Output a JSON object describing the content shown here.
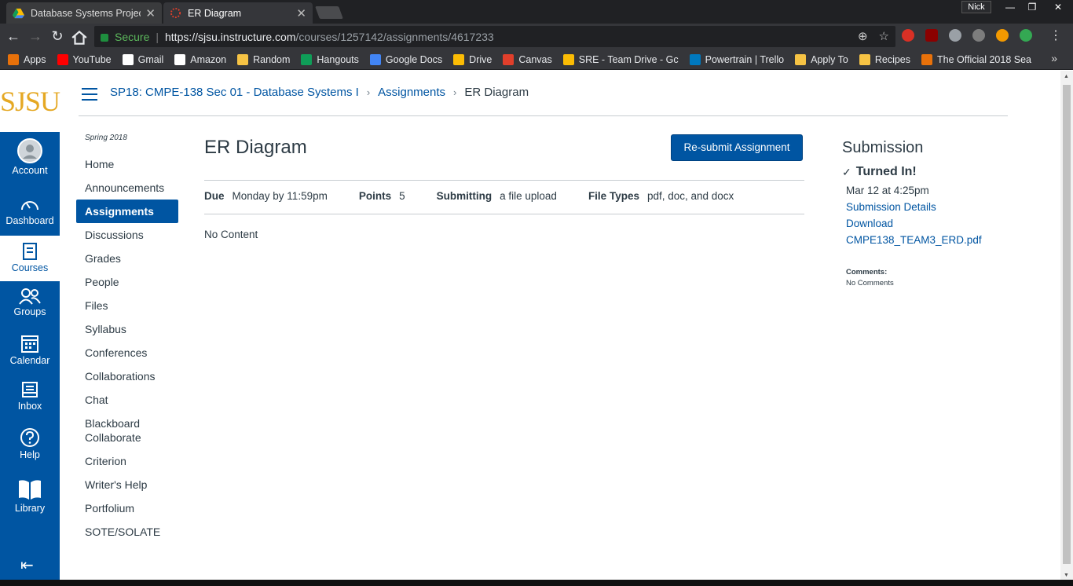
{
  "browser": {
    "tabs": [
      {
        "title": "Database Systems Projec",
        "active": false
      },
      {
        "title": "ER Diagram",
        "active": true
      }
    ],
    "profile": "Nick",
    "secure_label": "Secure",
    "url_host": "https://sjsu.instructure.com",
    "url_path": "/courses/1257142/assignments/4617233",
    "bookmarks": [
      {
        "label": "Apps",
        "icon": "apps-grid-icon",
        "color": "#e8710a"
      },
      {
        "label": "YouTube",
        "icon": "youtube-icon",
        "color": "#ff0000"
      },
      {
        "label": "Gmail",
        "icon": "gmail-icon",
        "color": "#ffffff"
      },
      {
        "label": "Amazon",
        "icon": "amazon-icon",
        "color": "#ffffff"
      },
      {
        "label": "Random",
        "icon": "folder-icon",
        "color": "#f6c344"
      },
      {
        "label": "Hangouts",
        "icon": "hangouts-icon",
        "color": "#0f9d58"
      },
      {
        "label": "Google Docs",
        "icon": "docs-icon",
        "color": "#4285f4"
      },
      {
        "label": "Drive",
        "icon": "drive-icon",
        "color": "#fbbc04"
      },
      {
        "label": "Canvas",
        "icon": "canvas-icon",
        "color": "#e13f2b"
      },
      {
        "label": "SRE - Team Drive - Gc",
        "icon": "drive-icon",
        "color": "#fbbc04"
      },
      {
        "label": "Powertrain | Trello",
        "icon": "trello-icon",
        "color": "#0079bf"
      },
      {
        "label": "Apply To",
        "icon": "folder-icon",
        "color": "#f6c344"
      },
      {
        "label": "Recipes",
        "icon": "folder-icon",
        "color": "#f6c344"
      },
      {
        "label": "The Official 2018 Sea",
        "icon": "bookmark-icon",
        "color": "#e8710a"
      }
    ],
    "more_bookmarks": "»"
  },
  "canvas": {
    "logo": "SJSU",
    "global_nav": [
      {
        "label": "Account",
        "icon": "account-icon",
        "current": false
      },
      {
        "label": "Dashboard",
        "icon": "dashboard-icon",
        "current": false
      },
      {
        "label": "Courses",
        "icon": "courses-icon",
        "current": true
      },
      {
        "label": "Groups",
        "icon": "groups-icon",
        "current": false
      },
      {
        "label": "Calendar",
        "icon": "calendar-icon",
        "current": false
      },
      {
        "label": "Inbox",
        "icon": "inbox-icon",
        "current": false
      },
      {
        "label": "Help",
        "icon": "help-icon",
        "current": false
      },
      {
        "label": "Library",
        "icon": "library-icon",
        "current": false
      }
    ],
    "breadcrumb": {
      "course": "SP18: CMPE-138 Sec 01 - Database Systems I",
      "section": "Assignments",
      "current": "ER Diagram"
    },
    "term": "Spring 2018",
    "course_nav": [
      "Home",
      "Announcements",
      "Assignments",
      "Discussions",
      "Grades",
      "People",
      "Files",
      "Syllabus",
      "Conferences",
      "Collaborations",
      "Chat",
      "Blackboard Collaborate",
      "Criterion",
      "Writer's Help",
      "Portfolium",
      "SOTE/SOLATE"
    ],
    "active_course_nav": "Assignments",
    "assignment": {
      "title": "ER Diagram",
      "resubmit_label": "Re-submit Assignment",
      "due_label": "Due",
      "due_value": "Monday by 11:59pm",
      "points_label": "Points",
      "points_value": "5",
      "submitting_label": "Submitting",
      "submitting_value": "a file upload",
      "filetypes_label": "File Types",
      "filetypes_value": "pdf, doc, and docx",
      "content": "No Content"
    },
    "submission": {
      "heading": "Submission",
      "status": "Turned In!",
      "date": "Mar 12 at 4:25pm",
      "details_link": "Submission Details",
      "download_link": "Download",
      "file_link": "CMPE138_TEAM3_ERD.pdf",
      "comments_label": "Comments:",
      "comments_value": "No Comments"
    }
  }
}
